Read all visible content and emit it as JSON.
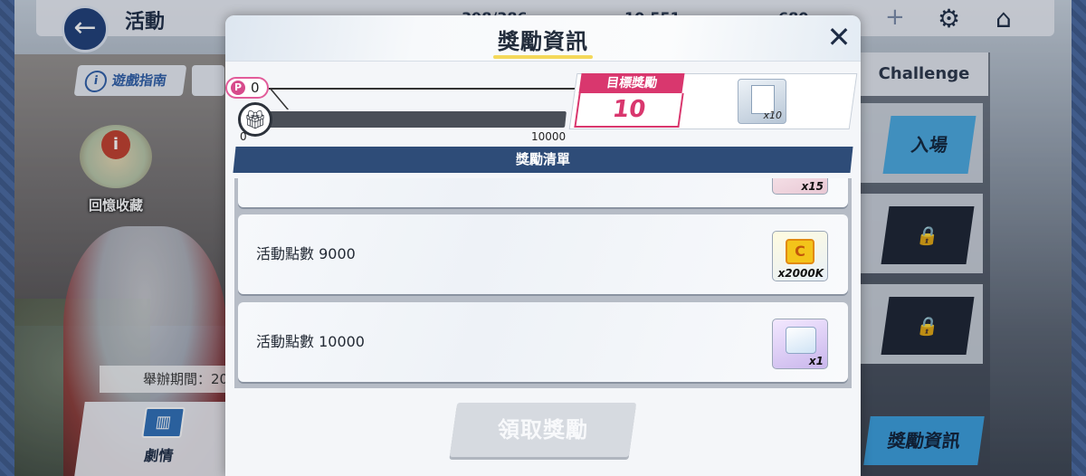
{
  "screen": {
    "title": "活動",
    "guide_label": "遊戲指南",
    "memory_label": "回憶收藏",
    "period_label": "舉辦期間：20",
    "story_label": "劇情",
    "right_tabs": {
      "challenge": "Challenge",
      "enter": "入場",
      "reward_info": "獎勵資訊"
    },
    "resources": [
      "398/386",
      "10,551",
      "680"
    ]
  },
  "modal": {
    "title": "獎勵資訊",
    "close_icon": "close-icon",
    "points_badge": {
      "symbol": "P",
      "value": "0"
    },
    "progress": {
      "min_label": "0",
      "max_label": "10000",
      "current": 0,
      "max": 10000
    },
    "target": {
      "label": "目標獎勵",
      "value": "10",
      "item_count": "x10"
    },
    "list_header": "獎勵清單",
    "rewards": [
      {
        "label": "",
        "count": "x15"
      },
      {
        "label": "活動點數 9000",
        "count": "x2000K"
      },
      {
        "label": "活動點數 10000",
        "count": "x1"
      }
    ],
    "claim_button": "領取獎勵"
  },
  "colors": {
    "accent_pink": "#d9376e",
    "header_blue": "#2e4c78",
    "title_underline": "#f4d85a"
  }
}
